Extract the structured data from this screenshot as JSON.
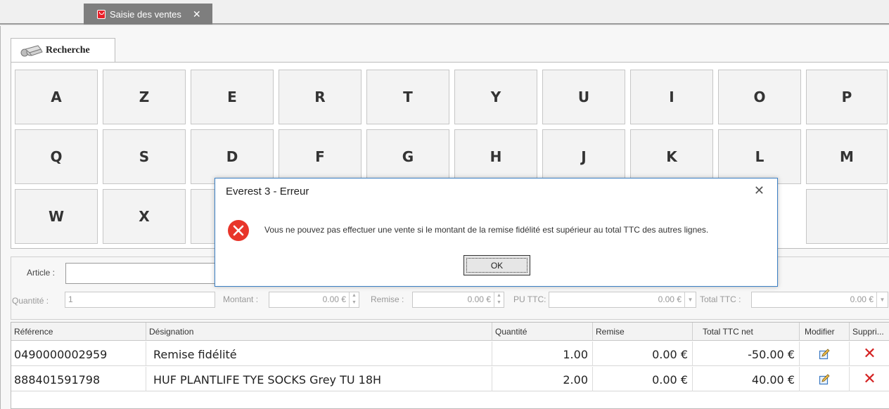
{
  "tab": {
    "label": "Saisie des ventes",
    "close": "✕"
  },
  "search_tab": {
    "label": "Recherche"
  },
  "keyboard": {
    "rows": [
      [
        "A",
        "Z",
        "E",
        "R",
        "T",
        "Y",
        "U",
        "I",
        "O",
        "P"
      ],
      [
        "Q",
        "S",
        "D",
        "F",
        "G",
        "H",
        "J",
        "K",
        "L",
        "M"
      ],
      [
        "W",
        "X"
      ]
    ]
  },
  "form": {
    "article_label": "Article :",
    "quantite_label": "Quantité :",
    "quantite_value": "1",
    "montant_label": "Montant :",
    "montant_value": "0.00 €",
    "remise_label": "Remise :",
    "remise_value": "0.00 €",
    "pu_ttc_label": "PU TTC:",
    "pu_ttc_value": "0.00 €",
    "total_ttc_label": "Total TTC :",
    "total_ttc_value": "0.00 €"
  },
  "table": {
    "headers": [
      "Référence",
      "Désignation",
      "Quantité",
      "Remise",
      "Total TTC net",
      "Modifier",
      "Suppri..."
    ],
    "rows": [
      {
        "ref": "0490000002959",
        "designation": "Remise fidélité",
        "quantite": "1.00",
        "remise": "0.00 €",
        "total": "-50.00 €"
      },
      {
        "ref": "888401591798",
        "designation": "HUF PLANTLIFE TYE SOCKS Grey TU 18H",
        "quantite": "2.00",
        "remise": "0.00 €",
        "total": "40.00 €"
      }
    ]
  },
  "dialog": {
    "title": "Everest 3 - Erreur",
    "close": "✕",
    "message": "Vous ne pouvez pas effectuer une vente si le montant de la remise fidélité est supérieur au total TTC des autres lignes.",
    "ok_label": "OK",
    "icon": "error-icon"
  },
  "colors": {
    "error_red": "#e8352a",
    "delete_red": "#d42020",
    "dialog_border": "#3b7fc4",
    "tab_bg": "#7e7e7e"
  }
}
